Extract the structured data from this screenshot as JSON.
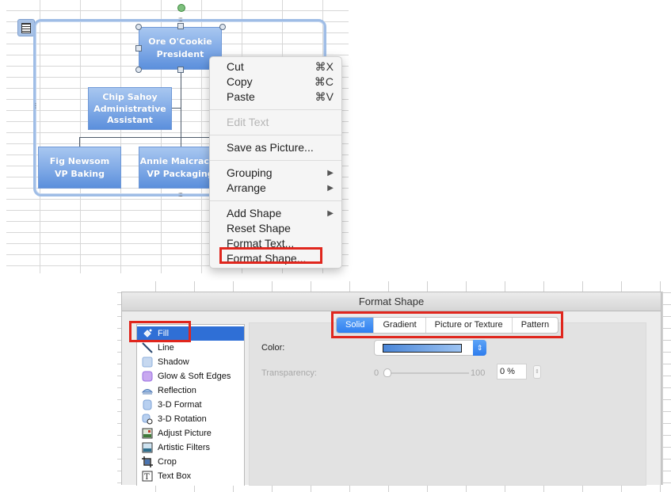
{
  "org_chart": {
    "nodes": [
      {
        "name": "Ore O'Cookie",
        "title": "President"
      },
      {
        "name": "Chip Sahoy",
        "title": "Administrative Assistant",
        "title_lines": [
          "Administrative",
          "Assistant"
        ]
      },
      {
        "name": "Fig Newsom",
        "title": "VP Baking"
      },
      {
        "name": "Annie Malcracke",
        "title": "VP Packaging"
      }
    ],
    "box_color": "#7fa9e6"
  },
  "context_menu": {
    "items": [
      {
        "label": "Cut",
        "shortcut": "⌘X"
      },
      {
        "label": "Copy",
        "shortcut": "⌘C"
      },
      {
        "label": "Paste",
        "shortcut": "⌘V"
      },
      {
        "label": "Edit Text",
        "disabled": true
      },
      {
        "label": "Save as Picture..."
      },
      {
        "label": "Grouping",
        "submenu": "▶"
      },
      {
        "label": "Arrange",
        "submenu": "▶"
      },
      {
        "label": "Add Shape",
        "submenu": "▶"
      },
      {
        "label": "Reset Shape"
      },
      {
        "label": "Format Text..."
      },
      {
        "label": "Format Shape...",
        "highlighted": true
      }
    ]
  },
  "format_shape_dialog": {
    "title": "Format Shape",
    "categories": [
      {
        "label": "Fill",
        "icon": "paint-bucket-icon",
        "selected": true
      },
      {
        "label": "Line",
        "icon": "line-icon"
      },
      {
        "label": "Shadow",
        "icon": "shadow-icon"
      },
      {
        "label": "Glow & Soft Edges",
        "icon": "glow-icon"
      },
      {
        "label": "Reflection",
        "icon": "reflection-icon"
      },
      {
        "label": "3-D Format",
        "icon": "3d-format-icon"
      },
      {
        "label": "3-D Rotation",
        "icon": "3d-rotation-icon"
      },
      {
        "label": "Adjust Picture",
        "icon": "adjust-picture-icon"
      },
      {
        "label": "Artistic Filters",
        "icon": "artistic-filters-icon"
      },
      {
        "label": "Crop",
        "icon": "crop-icon"
      },
      {
        "label": "Text Box",
        "icon": "text-box-icon"
      }
    ],
    "fill_tabs": [
      {
        "label": "Solid",
        "active": true
      },
      {
        "label": "Gradient"
      },
      {
        "label": "Picture or Texture"
      },
      {
        "label": "Pattern"
      }
    ],
    "color_label": "Color:",
    "transparency_label": "Transparency:",
    "transparency_min": "0",
    "transparency_max": "100",
    "transparency_value": "0 %",
    "transparency_percent": 0,
    "selected_color": "#4a86d8"
  },
  "annotation_color": "#e0261d",
  "selection_color": "#2f6fd6"
}
